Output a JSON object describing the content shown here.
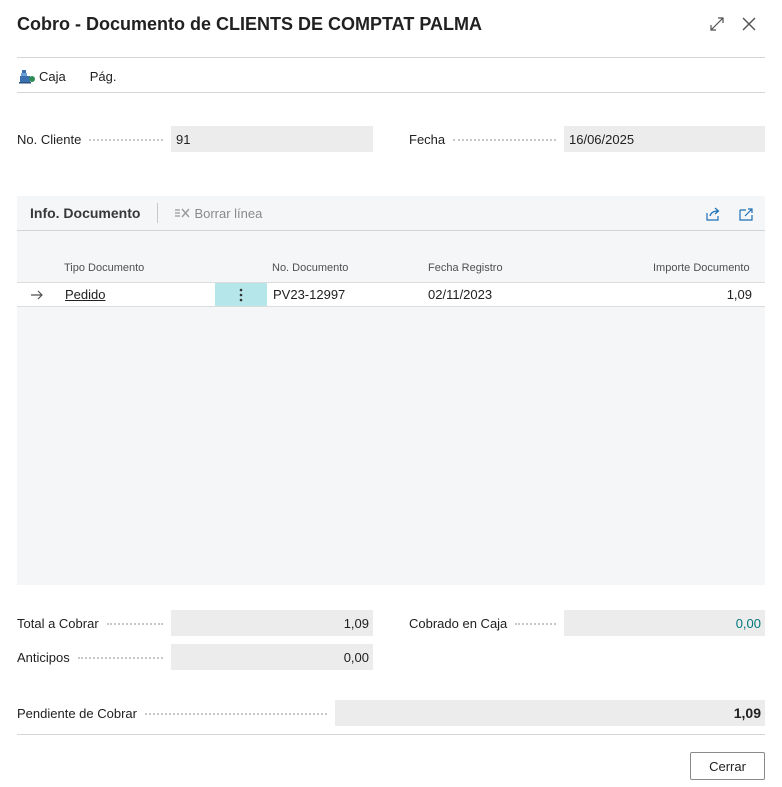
{
  "dialog": {
    "title": "Cobro - Documento de CLIENTS DE COMPTAT PALMA"
  },
  "actions": [
    {
      "label": "Caja",
      "icon": "cash-register-icon"
    },
    {
      "label": "Pág."
    }
  ],
  "header_fields": {
    "customer_no": {
      "label": "No. Cliente",
      "value": "91"
    },
    "date": {
      "label": "Fecha",
      "value": "16/06/2025"
    }
  },
  "doc_part": {
    "title": "Info. Documento",
    "delete_line_label": "Borrar línea",
    "columns": {
      "doc_type": "Tipo Documento",
      "doc_no": "No. Documento",
      "posting_date": "Fecha Registro",
      "amount": "Importe Documento"
    },
    "rows": [
      {
        "doc_type": "Pedido",
        "doc_no": "PV23-12997",
        "posting_date": "02/11/2023",
        "amount": "1,09"
      }
    ]
  },
  "totals": {
    "total_to_collect": {
      "label": "Total a Cobrar",
      "value": "1,09"
    },
    "collected_in_cash": {
      "label": "Cobrado en Caja",
      "value": "0,00"
    },
    "advances": {
      "label": "Anticipos",
      "value": "0,00"
    },
    "pending": {
      "label": "Pendiente de Cobrar",
      "value": "1,09"
    }
  },
  "footer": {
    "close_label": "Cerrar"
  },
  "colors": {
    "accent_teal": "#00777d",
    "row_menu_bg": "#b4e6ea"
  }
}
